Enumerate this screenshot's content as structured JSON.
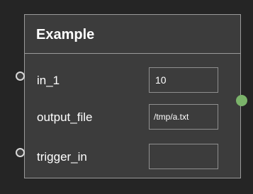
{
  "node": {
    "title": "Example",
    "rows": [
      {
        "label": "in_1",
        "value": "10",
        "has_input_port": true
      },
      {
        "label": "output_file",
        "value": "/tmp/a.txt",
        "has_input_port": false
      },
      {
        "label": "trigger_in",
        "value": "",
        "has_input_port": true
      }
    ],
    "output_port": true
  },
  "colors": {
    "background": "#252525",
    "node_fill": "#3c3c3c",
    "node_border": "#9a9a9a",
    "text": "#ffffff",
    "input_port_stroke": "#d8d8d8",
    "output_port_fill": "#7bb36a"
  }
}
